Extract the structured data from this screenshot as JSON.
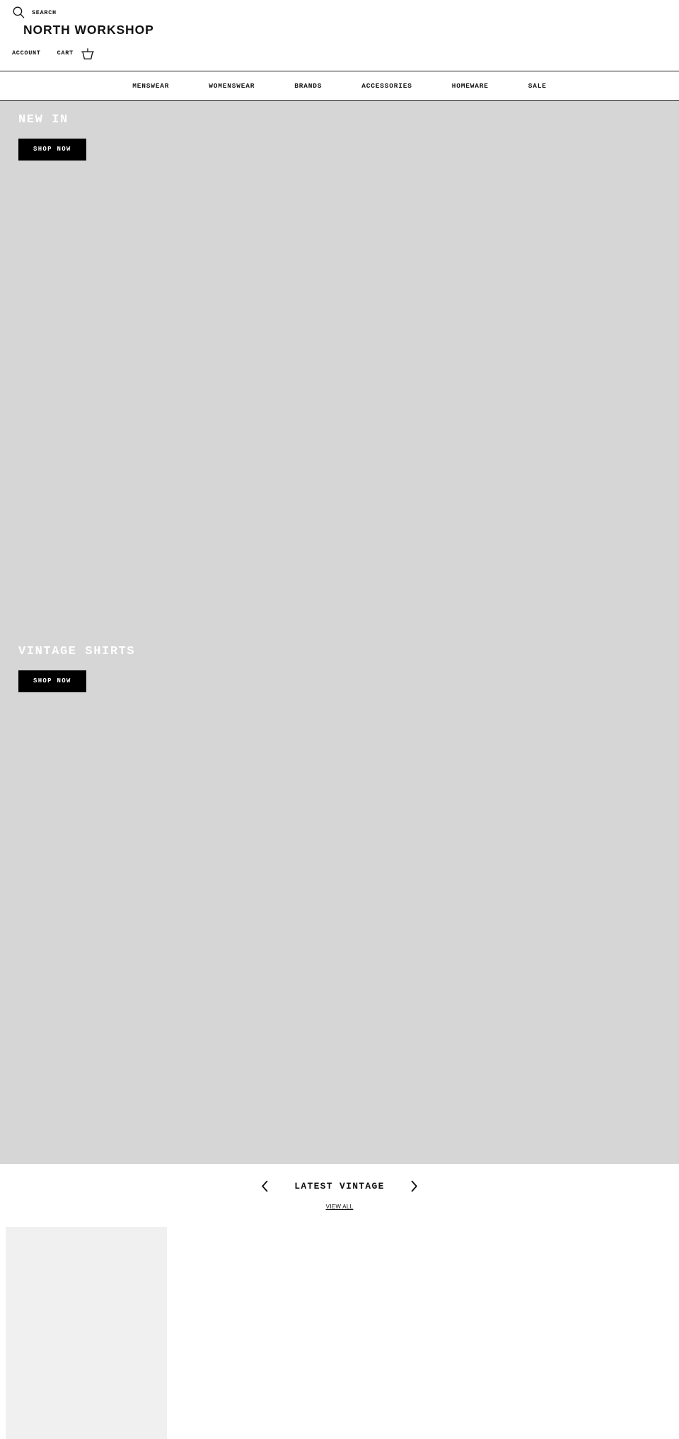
{
  "header": {
    "search": {
      "label": "SEARCH",
      "icon": "search-icon"
    },
    "brand": "NORTH WORKSHOP",
    "account_label": "ACCOUNT",
    "cart_label": "CART",
    "cart_icon": "shopping-basket-icon"
  },
  "nav": {
    "items": [
      {
        "label": "MENSWEAR"
      },
      {
        "label": "WOMENSWEAR"
      },
      {
        "label": "BRANDS"
      },
      {
        "label": "ACCESSORIES"
      },
      {
        "label": "HOMEWARE"
      },
      {
        "label": "SALE"
      }
    ]
  },
  "heroes": [
    {
      "title": "NEW IN",
      "cta": "SHOP NOW"
    },
    {
      "title": "VINTAGE SHIRTS",
      "cta": "SHOP NOW"
    }
  ],
  "collection": {
    "title": "LATEST VINTAGE",
    "prev_icon": "chevron-left-icon",
    "next_icon": "chevron-right-icon",
    "view_all": "VIEW ALL"
  },
  "colors": {
    "hero_background": "#d6d6d6",
    "cta_background": "#000000",
    "cta_text": "#ffffff",
    "text": "#111111",
    "page_background": "#ffffff",
    "product_placeholder": "#f0f0f0"
  }
}
